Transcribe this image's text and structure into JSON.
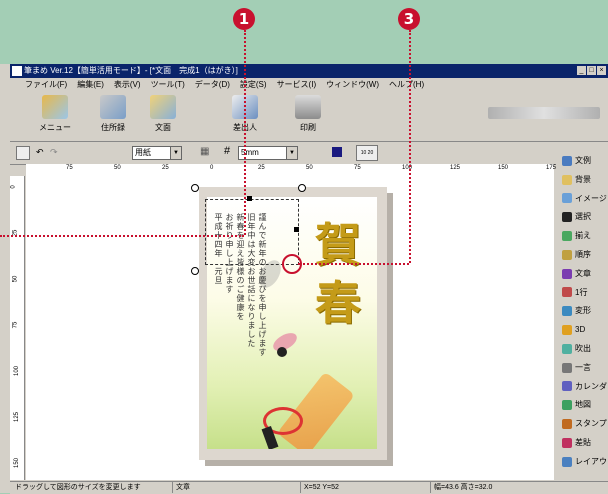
{
  "callouts": {
    "c1": "1",
    "c3": "3"
  },
  "window": {
    "title": "筆まめ Ver.12【簡単活用モード】- [*文面　完成1（はがき）]",
    "controls": {
      "min": "_",
      "max": "□",
      "close": "×"
    }
  },
  "menu": [
    "ファイル(F)",
    "編集(E)",
    "表示(V)",
    "ツール(T)",
    "データ(D)",
    "設定(S)",
    "サービス(I)",
    "ウィンドウ(W)",
    "ヘルプ(H)"
  ],
  "toolbar": {
    "buttons": [
      {
        "label": "メニュー",
        "icon": "menu-icon"
      },
      {
        "label": "住所録",
        "icon": "address-book-icon"
      },
      {
        "label": "文面",
        "icon": "card-design-icon"
      },
      {
        "label": "差出人",
        "icon": "sender-icon"
      },
      {
        "label": "印刷",
        "icon": "printer-icon"
      }
    ]
  },
  "toolbar2": {
    "paper_select": "用紙",
    "grid_select": "5mm",
    "zoom": "10 20"
  },
  "ruler": {
    "h_ticks": [
      "75",
      "50",
      "25",
      "0",
      "25",
      "50",
      "75",
      "100",
      "125",
      "150",
      "175"
    ],
    "v_ticks": [
      "0",
      "25",
      "50",
      "75",
      "100",
      "125",
      "150"
    ]
  },
  "card": {
    "kanji_top": "賀",
    "kanji_bottom": "春",
    "message_col1": "ご無沙汰しており",
    "message_lines": "謹んで新年のお慶びを申し上げます\n旧年中は大変お世話になりました\n新春を迎え皆様のご健康を\nお祈り申し上げます\n平成十四年　元旦",
    "side_text": "ほど　いらっしゃ",
    "left_col": "にほ\nいらしゃ"
  },
  "palette": {
    "items": [
      {
        "label": "文例",
        "icon": "example-icon"
      },
      {
        "label": "背景",
        "icon": "background-icon"
      },
      {
        "label": "イメージ",
        "icon": "image-icon"
      },
      {
        "label": "選択",
        "icon": "select-arrow-icon"
      },
      {
        "label": "揃え",
        "icon": "align-icon"
      },
      {
        "label": "順序",
        "icon": "order-icon"
      },
      {
        "label": "文章",
        "icon": "text-icon"
      },
      {
        "label": "1行",
        "icon": "one-line-icon"
      },
      {
        "label": "変形",
        "icon": "transform-icon"
      },
      {
        "label": "3D",
        "icon": "3d-icon"
      },
      {
        "label": "吹出",
        "icon": "balloon-icon"
      },
      {
        "label": "一言",
        "icon": "one-word-icon"
      },
      {
        "label": "カレンダ",
        "icon": "calendar-icon"
      },
      {
        "label": "地図",
        "icon": "map-icon"
      },
      {
        "label": "スタンプ",
        "icon": "stamp-icon"
      },
      {
        "label": "差貼",
        "icon": "paste-icon"
      },
      {
        "label": "レイアウト",
        "icon": "layout-icon"
      }
    ]
  },
  "status": {
    "hint": "ドラッグして図形のサイズを変更します",
    "mode": "文章",
    "coords": "X=52 Y=52",
    "size": "幅=43.6 高さ=32.0"
  },
  "colors": {
    "accent": "#c8102e",
    "titlebar": "#0a246a",
    "background": "#a3ceb5"
  }
}
